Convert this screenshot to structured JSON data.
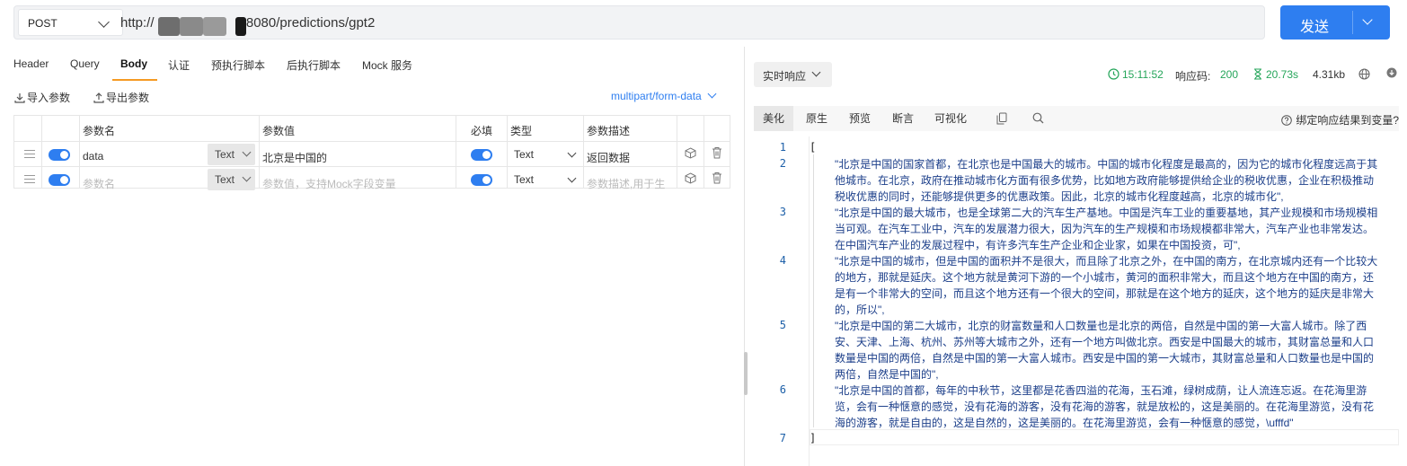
{
  "request": {
    "method": "POST",
    "url_prefix": "http://",
    "url_suffix": "18080/predictions/gpt2",
    "send_label": "发送"
  },
  "left": {
    "tabs": [
      "Header",
      "Query",
      "Body",
      "认证",
      "预执行脚本",
      "后执行脚本",
      "Mock 服务"
    ],
    "active_tab": "Body",
    "import_label": "导入参数",
    "export_label": "导出参数",
    "content_type": "multipart/form-data",
    "columns": [
      "参数名",
      "参数值",
      "必填",
      "类型",
      "参数描述"
    ],
    "rows": [
      {
        "name": "data",
        "value_type": "Text",
        "value": "北京是中国的",
        "type": "Text",
        "desc": "返回数据"
      }
    ],
    "new_row": {
      "name_placeholder": "参数名",
      "value_type": "Text",
      "value_placeholder": "参数值，支持Mock字段变量",
      "type": "Text",
      "desc_placeholder": "参数描述,用于生"
    }
  },
  "right": {
    "response_mode": "实时响应",
    "time": "15:11:52",
    "status_label": "响应码:",
    "status_code": "200",
    "duration": "20.73s",
    "size": "4.31kb",
    "subtabs": [
      "美化",
      "原生",
      "预览",
      "断言",
      "可视化"
    ],
    "active_subtab": "美化",
    "bind_label": "绑定响应结果到变量?",
    "line_numbers": [
      "1",
      "2",
      "3",
      "4",
      "5",
      "6",
      "7"
    ],
    "open_bracket": "[",
    "close_bracket": "]",
    "lines": [
      "\"北京是中国的国家首都，在北京也是中国最大的城市。中国的城市化程度是最高的，因为它的城市化程度远高于其他城市。在北京，政府在推动城市化方面有很多优势，比如地方政府能够提供给企业的税收优惠，企业在积极推动税收优惠的同时，还能够提供更多的优惠政策。因此，北京的城市化程度越高，北京的城市化\",",
      "\"北京是中国的最大城市，也是全球第二大的汽车生产基地。中国是汽车工业的重要基地，其产业规模和市场规模相当可观。在汽车工业中，汽车的发展潜力很大，因为汽车的生产规模和市场规模都非常大，汽车产业也非常发达。在中国汽车产业的发展过程中，有许多汽车生产企业和企业家，如果在中国投资，可\",",
      "\"北京是中国的城市，但是中国的面积并不是很大，而且除了北京之外，在中国的南方，在北京城内还有一个比较大的地方，那就是延庆。这个地方就是黄河下游的一个小城市，黄河的面积非常大，而且这个地方在中国的南方，还是有一个非常大的空间，而且这个地方还有一个很大的空间，那就是在这个地方的延庆，这个地方的延庆是非常大的，所以\",",
      "\"北京是中国的第二大城市，北京的财富数量和人口数量也是北京的两倍，自然是中国的第一大富人城市。除了西安、天津、上海、杭州、苏州等大城市之外，还有一个地方叫做北京。西安是中国最大的城市，其财富总量和人口数量是中国的两倍，自然是中国的第一大富人城市。西安是中国的第一大城市，其财富总量和人口数量也是中国的两倍，自然是中国的\",",
      "\"北京是中国的首都，每年的中秋节，这里都是花香四溢的花海，玉石滩，绿树成荫，让人流连忘返。在花海里游览，会有一种惬意的感觉，没有花海的游客，没有花海的游客，就是放松的，这是美丽的。在花海里游览，没有花海的游客，就是自由的，这是自然的，这是美丽的。在花海里游览，会有一种惬意的感觉，\\ufffd\""
    ]
  },
  "colors": {
    "accent": "#2e7ef0",
    "tab_underline": "#f59a23",
    "success": "#25a55a"
  }
}
